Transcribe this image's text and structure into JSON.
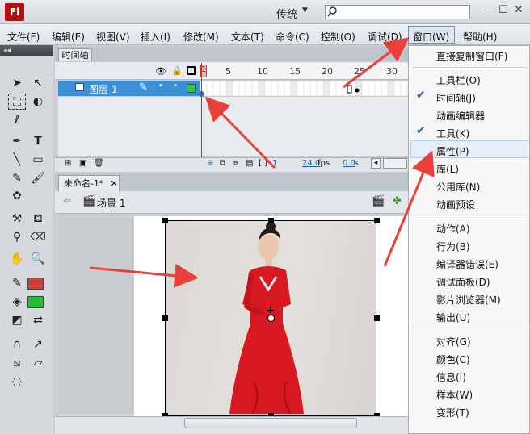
{
  "titlebar": {
    "app_logo": "Fl",
    "workspace": "传统",
    "window_buttons": [
      "—",
      "☐",
      "✕"
    ]
  },
  "menubar": {
    "items": [
      "文件(F)",
      "编辑(E)",
      "视图(V)",
      "插入(I)",
      "修改(M)",
      "文本(T)",
      "命令(C)",
      "控制(O)",
      "调试(D)",
      "窗口(W)",
      "帮助(H)"
    ]
  },
  "timeline": {
    "tab_label": "时间轴",
    "frame_numbers": [
      "1",
      "5",
      "10",
      "15",
      "20",
      "25",
      "30"
    ],
    "layer_name": "图层 1",
    "current_frame": "1",
    "fps": "24.0",
    "fps_unit": "fps",
    "time": "0.0",
    "time_unit": "s"
  },
  "document": {
    "tab_label": "未命名-1*",
    "scene_label": "场景 1"
  },
  "window_menu": {
    "items": [
      {
        "label": "直接复制窗口(F)",
        "checked": false
      },
      {
        "label": "工具栏(O)",
        "checked": false
      },
      {
        "label": "时间轴(J)",
        "checked": true
      },
      {
        "label": "动画编辑器",
        "checked": false
      },
      {
        "label": "工具(K)",
        "checked": true
      },
      {
        "label": "属性(P)",
        "checked": false,
        "highlighted": true
      },
      {
        "label": "库(L)",
        "checked": false
      },
      {
        "label": "公用库(N)",
        "checked": false
      },
      {
        "label": "动画预设",
        "checked": false
      },
      {
        "label": "动作(A)",
        "checked": false
      },
      {
        "label": "行为(B)",
        "checked": false
      },
      {
        "label": "编译器错误(E)",
        "checked": false
      },
      {
        "label": "调试面板(D)",
        "checked": false
      },
      {
        "label": "影片浏览器(M)",
        "checked": false
      },
      {
        "label": "输出(U)",
        "checked": false
      },
      {
        "label": "对齐(G)",
        "checked": false
      },
      {
        "label": "颜色(C)",
        "checked": false
      },
      {
        "label": "信息(I)",
        "checked": false
      },
      {
        "label": "样本(W)",
        "checked": false
      },
      {
        "label": "变形(T)",
        "checked": false
      }
    ]
  },
  "colors": {
    "stroke_color": "#d33a3a",
    "fill_color": "#22bb33",
    "annotation_arrow": "#e8403a",
    "layer_highlight": "#3d8fd8"
  }
}
